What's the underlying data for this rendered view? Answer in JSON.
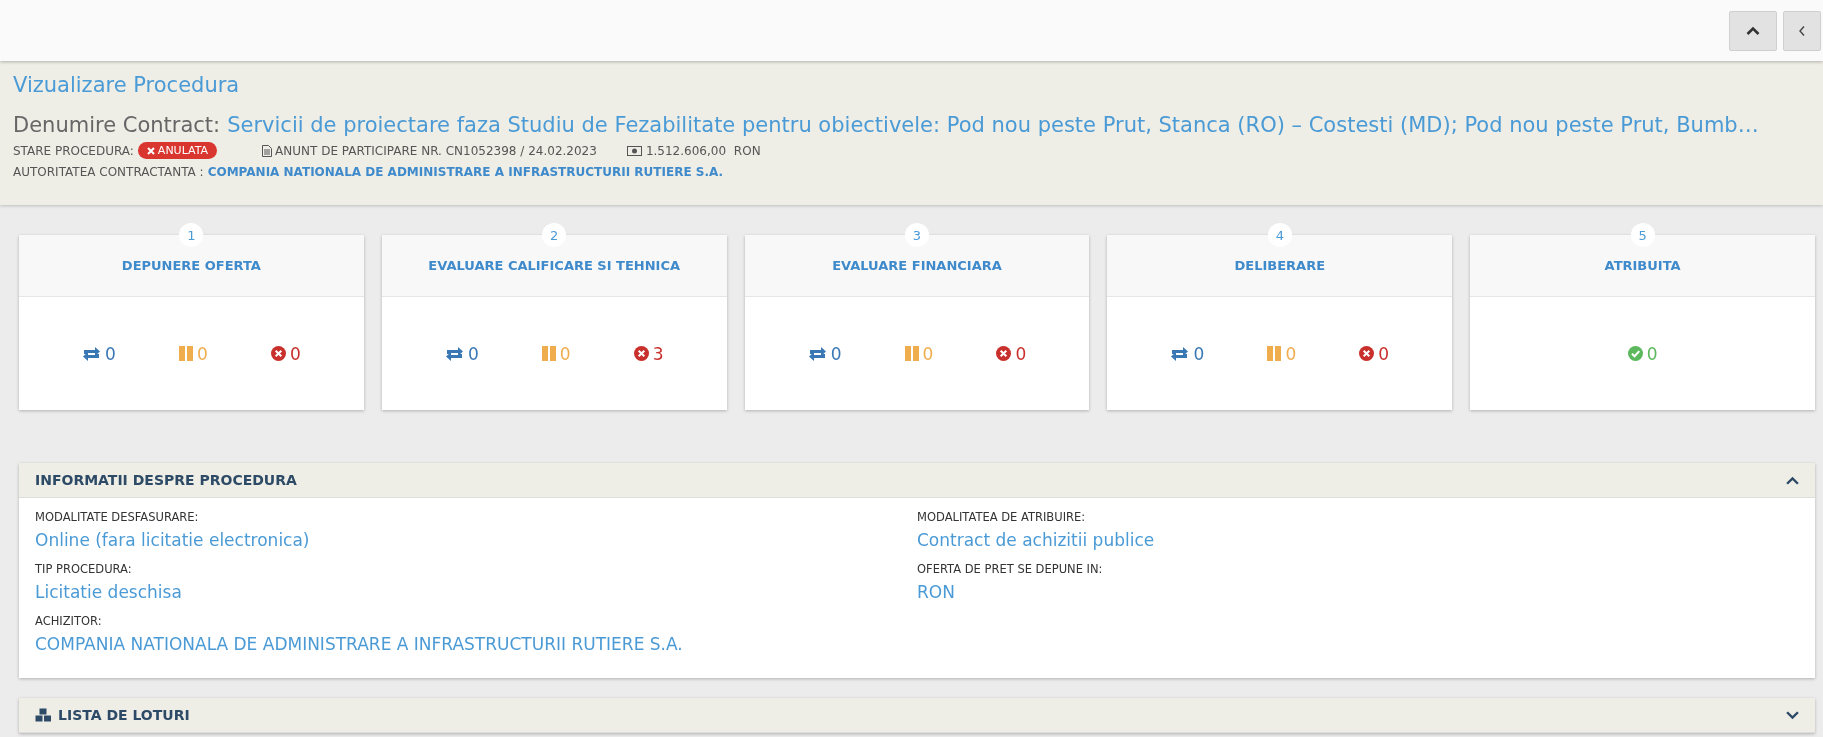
{
  "toolbar": {
    "buttons": [
      {
        "kind": "collapse"
      },
      {
        "kind": "back"
      }
    ]
  },
  "header": {
    "title": "Vizualizare Procedura",
    "contract_label": "Denumire Contract:",
    "contract_name": "Servicii de proiectare faza Studiu de Fezabilitate pentru obiectivele: Pod nou peste Prut, Stanca (RO) – Costesti (MD); Pod nou peste Prut, Bumb…",
    "status_label": "STARE PROCEDURA:",
    "status": "ANULATA",
    "notice": "ANUNT DE PARTICIPARE NR. CN1052398 / 24.02.2023",
    "value": "1.512.606,00",
    "currency": "RON",
    "authority_label": "AUTORITATEA CONTRACTANTA :",
    "authority": "COMPANIA NATIONALA DE ADMINISTRARE A INFRASTRUCTURII RUTIERE S.A."
  },
  "stages": [
    {
      "number": "1",
      "title": "DEPUNERE OFERTA",
      "counts": [
        {
          "kind": "in_progress",
          "value": "0"
        },
        {
          "kind": "paused",
          "value": "0"
        },
        {
          "kind": "rejected",
          "value": "0"
        }
      ]
    },
    {
      "number": "2",
      "title": "EVALUARE CALIFICARE SI TEHNICA",
      "counts": [
        {
          "kind": "in_progress",
          "value": "0"
        },
        {
          "kind": "paused",
          "value": "0"
        },
        {
          "kind": "rejected",
          "value": "3"
        }
      ]
    },
    {
      "number": "3",
      "title": "EVALUARE FINANCIARA",
      "counts": [
        {
          "kind": "in_progress",
          "value": "0"
        },
        {
          "kind": "paused",
          "value": "0"
        },
        {
          "kind": "rejected",
          "value": "0"
        }
      ]
    },
    {
      "number": "4",
      "title": "DELIBERARE",
      "counts": [
        {
          "kind": "in_progress",
          "value": "0"
        },
        {
          "kind": "paused",
          "value": "0"
        },
        {
          "kind": "rejected",
          "value": "0"
        }
      ]
    },
    {
      "number": "5",
      "title": "ATRIBUITA",
      "counts": [
        {
          "kind": "awarded",
          "value": "0"
        }
      ]
    }
  ],
  "info_panel": {
    "title": "INFORMATII DESPRE PROCEDURA",
    "expanded": true,
    "fields": [
      {
        "label": "MODALITATE DESFASURARE:",
        "value": "Online (fara licitatie electronica)"
      },
      {
        "label": "MODALITATEA DE ATRIBUIRE:",
        "value": "Contract de achizitii publice"
      },
      {
        "label": "TIP PROCEDURA:",
        "value": "Licitatie deschisa"
      },
      {
        "label": "OFERTA DE PRET SE DEPUNE IN:",
        "value": "RON"
      },
      {
        "label": "ACHIZITOR:",
        "value": "COMPANIA NATIONALA DE ADMINISTRARE A INFRASTRUCTURII RUTIERE S.A."
      }
    ]
  },
  "lots_panel": {
    "title": "LISTA DE LOTURI",
    "expanded": false
  }
}
